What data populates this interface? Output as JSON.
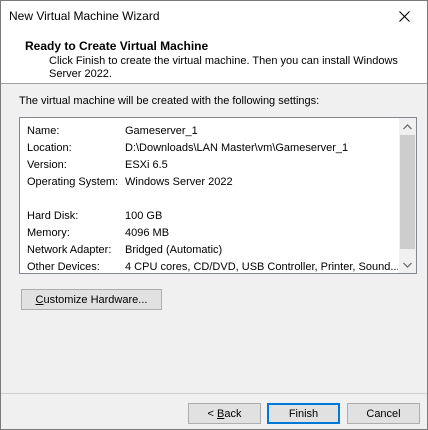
{
  "window": {
    "title": "New Virtual Machine Wizard",
    "close_icon": "close-icon"
  },
  "header": {
    "title": "Ready to Create Virtual Machine",
    "description": "Click Finish to create the virtual machine. Then you can install Windows Server 2022."
  },
  "intro": "The virtual machine will be created with the following settings:",
  "settings": [
    {
      "key": "Name:",
      "value": "Gameserver_1"
    },
    {
      "key": "Location:",
      "value": "D:\\Downloads\\LAN Master\\vm\\Gameserver_1"
    },
    {
      "key": "Version:",
      "value": "ESXi 6.5"
    },
    {
      "key": "Operating System:",
      "value": "Windows Server 2022"
    },
    {
      "key": "Hard Disk:",
      "value": "100 GB"
    },
    {
      "key": "Memory:",
      "value": "4096 MB"
    },
    {
      "key": "Network Adapter:",
      "value": "Bridged (Automatic)"
    },
    {
      "key": "Other Devices:",
      "value": "4 CPU cores, CD/DVD, USB Controller, Printer, Sound..."
    }
  ],
  "buttons": {
    "customize_pre": "",
    "customize_u": "C",
    "customize_post": "ustomize Hardware...",
    "back_pre": "< ",
    "back_u": "B",
    "back_post": "ack",
    "finish": "Finish",
    "cancel": "Cancel"
  }
}
